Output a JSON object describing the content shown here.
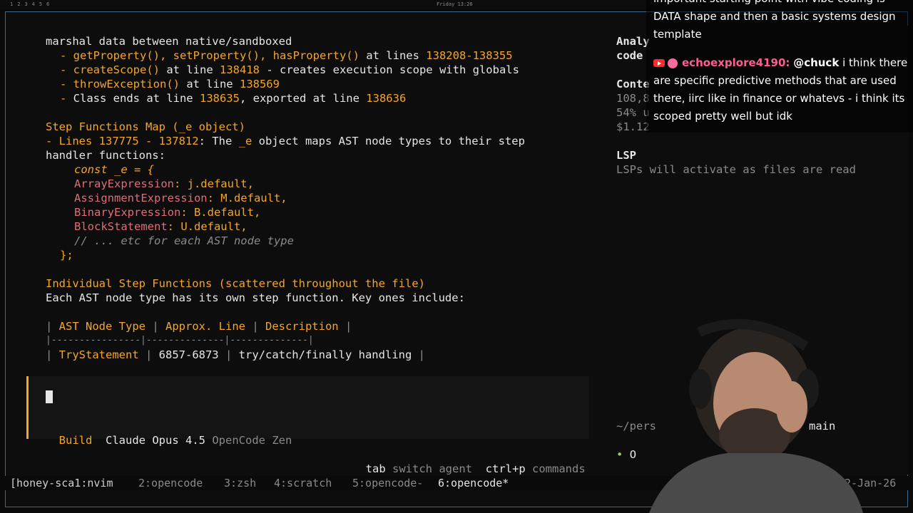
{
  "topbar": {
    "workspaces": [
      "1",
      "2",
      "3",
      "4",
      "5",
      "6"
    ],
    "clock": "Friday 13:26"
  },
  "content": {
    "marshal": "marshal data between native/sandboxed",
    "b1_fn": "getProperty(), setProperty(), hasProperty()",
    "b1_mid": " at lines ",
    "b1_num": "138208-138355",
    "b2_fn": "createScope()",
    "b2_mid": " at line ",
    "b2_num": "138418",
    "b2_rest": " - creates execution scope with globals",
    "b3_fn": "throwException()",
    "b3_mid": " at line ",
    "b3_num": "138569",
    "b4_pre": "Class ends at line ",
    "b4_num1": "138635",
    "b4_mid": ", exported at line ",
    "b4_num2": "138636",
    "h1": "Step Functions Map (_e object)",
    "lines_label": "Lines 137775 - 137812",
    "lines_rest1": ": The ",
    "lines_code": "_e",
    "lines_rest2": " object maps AST node types to their step",
    "handler": "handler functions:",
    "code_const": "const _e = {",
    "code_l1_key": "ArrayExpression",
    "code_l1_val": ": j.default,",
    "code_l2_key": "AssignmentExpression",
    "code_l2_val": ": M.default,",
    "code_l3_key": "BinaryExpression",
    "code_l3_val": ": B.default,",
    "code_l4_key": "BlockStatement",
    "code_l4_val": ": U.default,",
    "code_comment": "// ... etc for each AST node type",
    "code_close": "};",
    "h2": "Individual Step Functions (scattered throughout the file)",
    "each": "Each AST node type has its own step function. Key ones include:",
    "table_head": [
      "AST Node Type",
      "Approx. Line",
      "Description"
    ],
    "table_sep": "|----------------|--------------|--------------|",
    "table_row": [
      "TryStatement",
      "6857-6873",
      "try/catch/finally handling"
    ]
  },
  "prompt": {
    "mode": "Build",
    "model": "Claude Opus 4.5",
    "provider": "OpenCode Zen"
  },
  "hints": {
    "tab_key": "tab",
    "tab_label": "switch agent",
    "cmd_key": "ctrl+p",
    "cmd_label": "commands"
  },
  "right_panel": {
    "analysis_1": "Analy",
    "analysis_2": "code",
    "context_label": "Conte",
    "context_v1": "108,8",
    "context_v2": "54% u",
    "context_v3": "$1.12",
    "lsp_title": "LSP",
    "lsp_text": "LSPs will activate as files are read",
    "path": "~/pers",
    "branch": "main",
    "status_dot": "•",
    "status_text": "O"
  },
  "tmux": {
    "w1": "[honey-sca1:nvim",
    "w2": "2:opencode",
    "w3": "3:zsh",
    "w4": "4:scratch",
    "w5": "5:opencode-",
    "w6": "6:opencode*",
    "date": "2-Jan-26"
  },
  "chat": {
    "prev_text": "important starting point with vibe coding is DATA shape and then a basic systems design template",
    "username": "echoexplore4190:",
    "mention": "@chuck",
    "message": "i think there are specific predictive methods that are used there, iirc like in finance or whatevs - i think its scoped pretty well but idk"
  },
  "colors": {
    "accent": "#f5a623",
    "frame": "#3c6b8f",
    "chat_user": "#ff5d8f"
  }
}
